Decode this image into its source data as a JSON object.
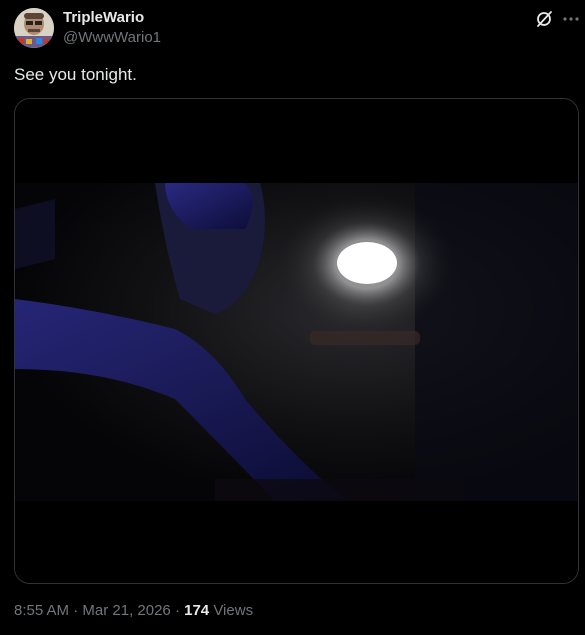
{
  "author": {
    "display_name": "TripleWario",
    "handle": "@WwwWario1",
    "avatar_icon": "avatar-image"
  },
  "post": {
    "text": "See you tonight.",
    "media_icon": "dark-image"
  },
  "actions": {
    "grok_icon": "grok-icon",
    "more_icon": "more-icon"
  },
  "meta": {
    "time": "8:55 AM",
    "separator": "·",
    "date": "Mar 21, 2026",
    "views_count": "174",
    "views_label": "Views"
  },
  "colors": {
    "background": "#000000",
    "primary_text": "#e7e9ea",
    "secondary_text": "#71767b",
    "border": "#2f3336"
  }
}
